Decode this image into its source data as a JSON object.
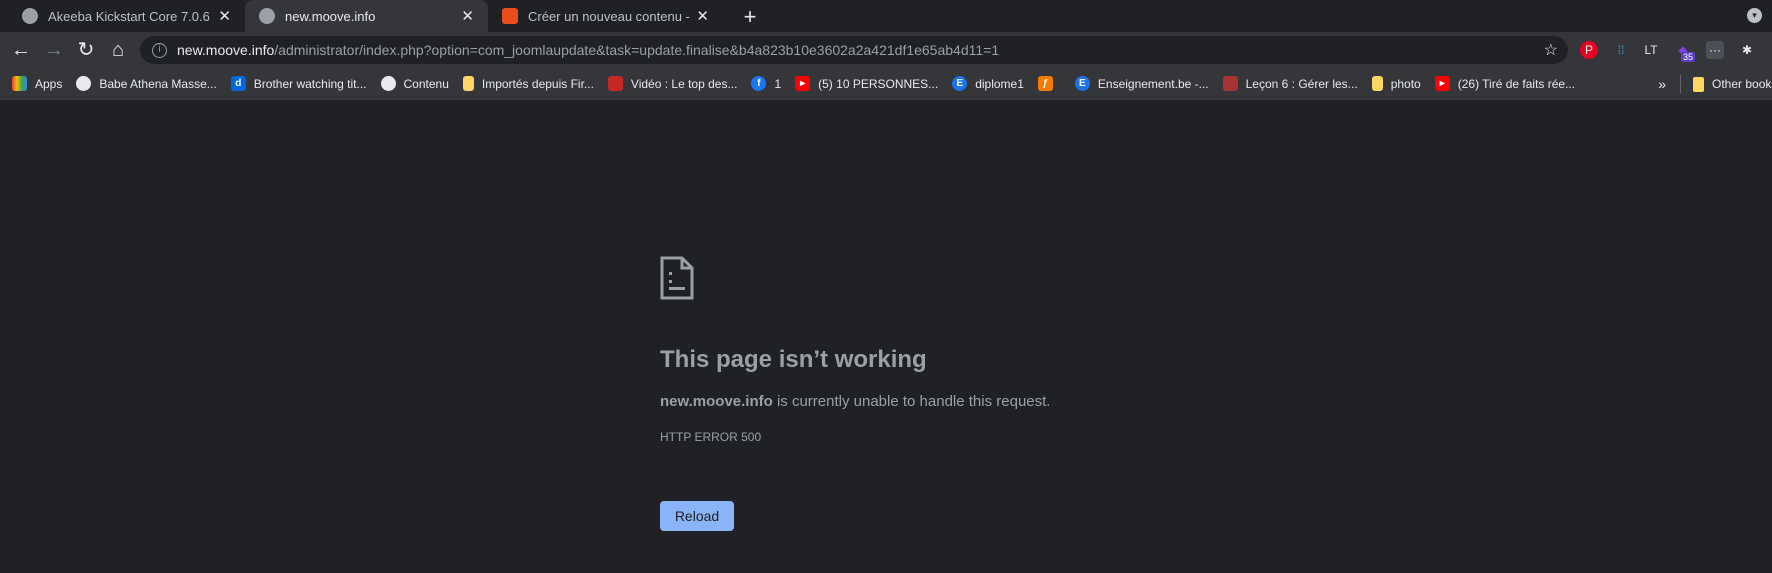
{
  "tabs": [
    {
      "title": "Akeeba Kickstart Core 7.0.6",
      "active": false
    },
    {
      "title": "new.moove.info",
      "active": true
    },
    {
      "title": "Créer un nouveau contenu - Forum",
      "active": false
    }
  ],
  "omnibox": {
    "host": "new.moove.info",
    "path": "/administrator/index.php?option=com_joomlaupdate&task=update.finalise&b4a823b10e3602a2a421df1e65ab4d11=1"
  },
  "extensions": {
    "badge": "35"
  },
  "bookmarks": [
    {
      "label": "Apps",
      "icon": "apps-grid-icon"
    },
    {
      "label": "Babe Athena Masse...",
      "icon": "globe-icon"
    },
    {
      "label": "Brother watching tit...",
      "icon": "dailymotion-icon"
    },
    {
      "label": "Contenu",
      "icon": "globe-icon"
    },
    {
      "label": "Importés depuis Fir...",
      "icon": "folder-icon"
    },
    {
      "label": "Vidéo : Le top des...",
      "icon": "site-icon"
    },
    {
      "label": "1",
      "icon": "facebook-icon"
    },
    {
      "label": "(5) 10 PERSONNES...",
      "icon": "youtube-icon"
    },
    {
      "label": "diplome1",
      "icon": "e-icon"
    },
    {
      "label": "",
      "icon": "pdf-icon"
    },
    {
      "label": "Enseignement.be -...",
      "icon": "e-icon"
    },
    {
      "label": "Leçon 6 : Gérer les...",
      "icon": "site-icon"
    },
    {
      "label": "photo",
      "icon": "folder-icon"
    },
    {
      "label": "(26) Tiré de faits rée...",
      "icon": "youtube-icon"
    }
  ],
  "bookmarks_more": "»",
  "other_bookmarks": "Other bookmarks",
  "error": {
    "title": "This page isn’t working",
    "host": "new.moove.info",
    "message": " is currently unable to handle this request.",
    "code": "HTTP ERROR 500",
    "reload": "Reload"
  },
  "colors": {
    "background": "#202124",
    "toolbar": "#35363a",
    "accent": "#8ab4f8"
  }
}
